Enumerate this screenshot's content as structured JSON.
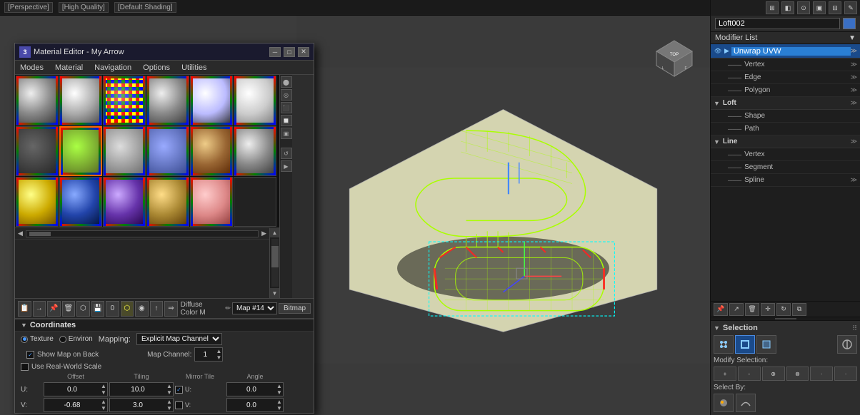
{
  "topbar": {
    "items": [
      "[Perspective]",
      "[High Quality]",
      "[Default Shading]"
    ]
  },
  "materialEditor": {
    "title": "Material Editor - My Arrow",
    "titleIcon": "3",
    "menus": [
      "Modes",
      "Material",
      "Navigation",
      "Options",
      "Utilities"
    ],
    "mapLabel": "Diffuse Color M",
    "mapDropdown": "Map #14",
    "mapBtn": "Bitmap",
    "sections": {
      "coordinates": {
        "label": "Coordinates",
        "texture": "Texture",
        "environ": "Environ",
        "mappingLabel": "Mapping:",
        "mappingValue": "Explicit Map Channel",
        "showMapOnBack": "Show Map on Back",
        "useRealWorldScale": "Use Real-World Scale",
        "mapChannelLabel": "Map Channel:",
        "mapChannelValue": "1",
        "columns": {
          "offset": "Offset",
          "tiling": "Tiling",
          "mirrorTile": "Mirror Tile",
          "angle": "Angle"
        },
        "uRow": {
          "label": "U:",
          "offset": "0.0",
          "tiling": "10.0",
          "mirrorU": "U:",
          "mirrorVal": "0.0",
          "angle": "0.0"
        },
        "vRow": {
          "label": "V:",
          "offset": "-0.68",
          "tiling": "3.0",
          "mirrorV": "V:",
          "mirrorVal": "0.0",
          "angle": "0.0"
        }
      }
    }
  },
  "rightPanel": {
    "objectName": "Loft002",
    "objectColor": "#3a6fc4",
    "modifierListLabel": "Modifier List",
    "modifiers": [
      {
        "id": "unwrap-uvw",
        "label": "Unwrap UVW",
        "active": true,
        "hasEye": true,
        "expandable": true
      },
      {
        "id": "vertex",
        "label": "Vertex",
        "sub": true
      },
      {
        "id": "edge",
        "label": "Edge",
        "sub": true
      },
      {
        "id": "polygon",
        "label": "Polygon",
        "sub": true
      },
      {
        "id": "loft-group",
        "label": "Loft",
        "group": true
      },
      {
        "id": "shape",
        "label": "Shape",
        "sub": true
      },
      {
        "id": "path",
        "label": "Path",
        "sub": true
      },
      {
        "id": "line-group",
        "label": "Line",
        "group": true
      },
      {
        "id": "vertex2",
        "label": "Vertex",
        "sub": true
      },
      {
        "id": "segment",
        "label": "Segment",
        "sub": true
      },
      {
        "id": "spline",
        "label": "Spline",
        "sub": true
      }
    ],
    "selection": {
      "label": "Selection",
      "modifySelection": "Modify Selection:",
      "selectBy": "Select By:"
    }
  },
  "viewport": {
    "label": "[Perspective] [High Quality] [Default Shading]"
  },
  "icons": {
    "eye": "👁",
    "expand": "▼",
    "collapse": "▲",
    "arrow_right": "▶",
    "arrow_down": "▼",
    "check": "✓"
  }
}
